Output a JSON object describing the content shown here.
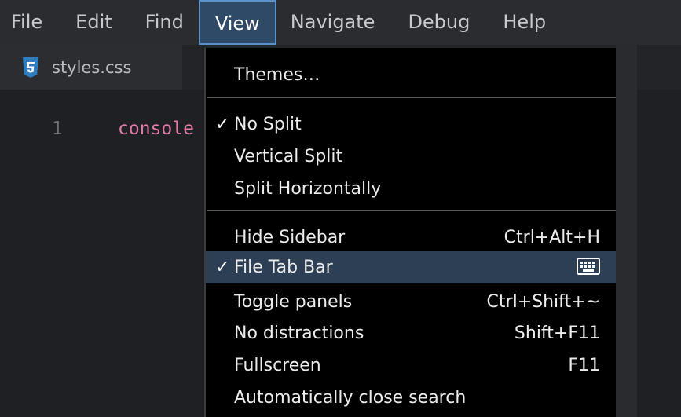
{
  "menubar": {
    "items": [
      "File",
      "Edit",
      "Find",
      "View",
      "Navigate",
      "Debug",
      "Help"
    ],
    "active": "View"
  },
  "tab": {
    "filename": "styles.css",
    "icon": "css3-icon"
  },
  "editor": {
    "line_number": "1",
    "code": "console"
  },
  "view_menu": {
    "themes": "Themes…",
    "no_split": "No Split",
    "vertical_split": "Vertical Split",
    "split_horizontally": "Split Horizontally",
    "hide_sidebar": "Hide Sidebar",
    "hide_sidebar_shortcut": "Ctrl+Alt+H",
    "file_tab_bar": "File Tab Bar",
    "toggle_panels": "Toggle panels",
    "toggle_panels_shortcut": "Ctrl+Shift+~",
    "no_distractions": "No distractions",
    "no_distractions_shortcut": "Shift+F11",
    "fullscreen": "Fullscreen",
    "fullscreen_shortcut": "F11",
    "auto_close_search": "Automatically close search",
    "check_mark": "✓"
  },
  "colors": {
    "menu_active_bg": "#2f4a66",
    "menu_active_border": "#5b93c9",
    "highlight_bg": "#2c3f55",
    "code_keyword": "#e07aa9",
    "css_icon": "#2e7dbf"
  }
}
